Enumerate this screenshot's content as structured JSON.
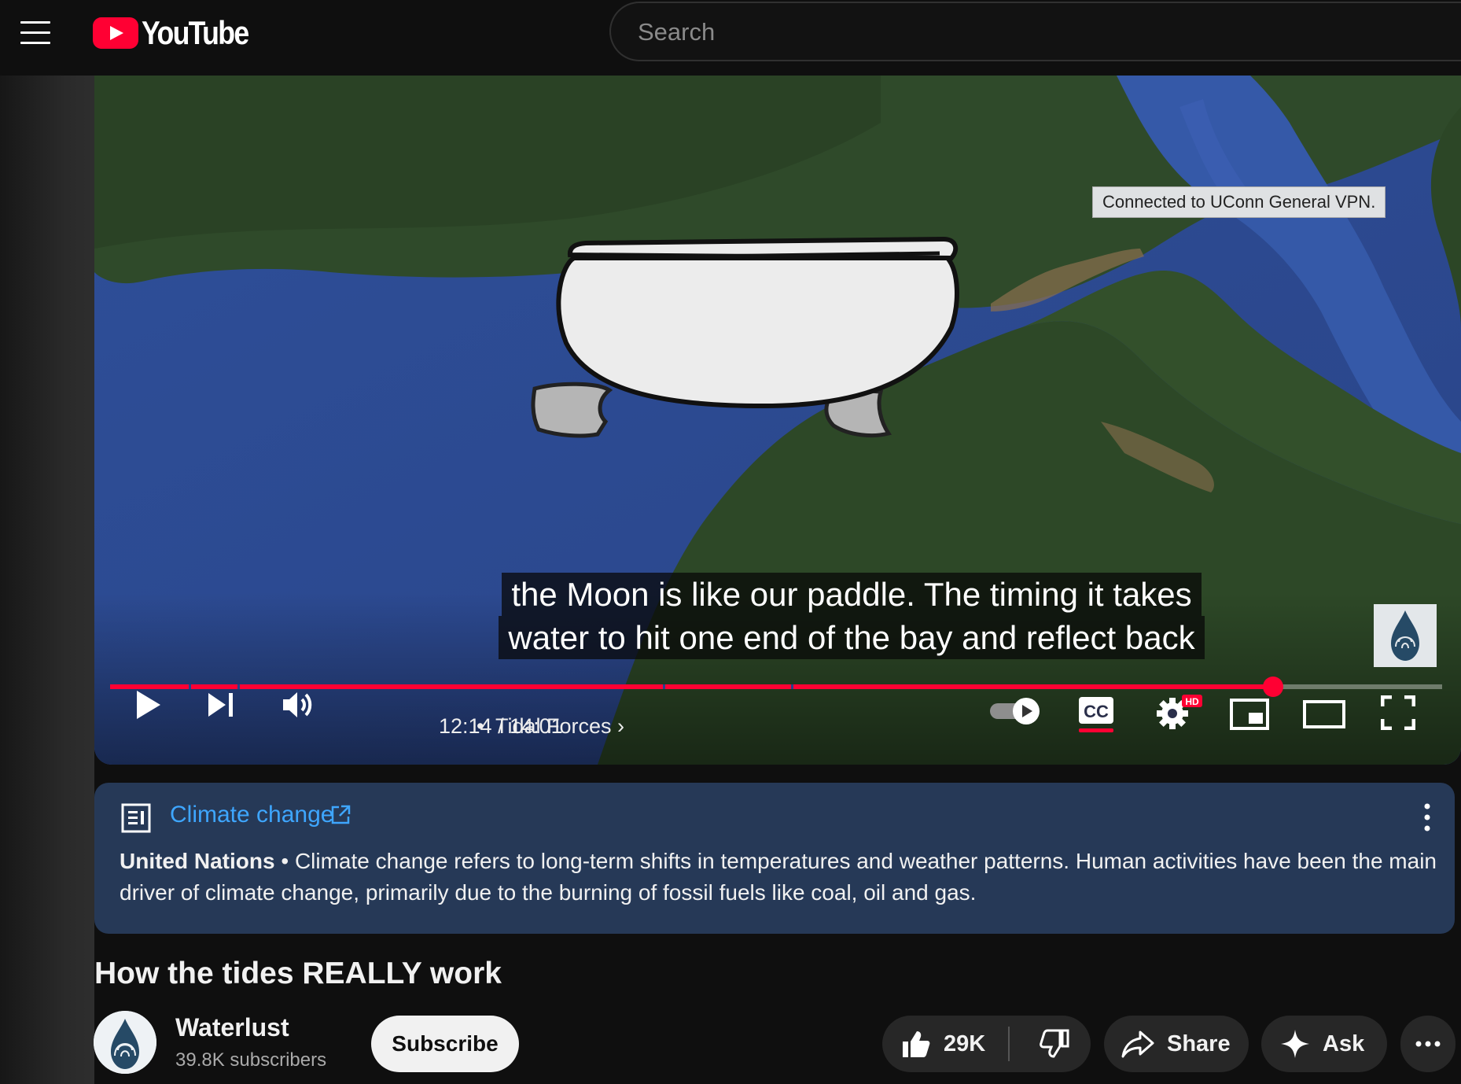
{
  "header": {
    "logo_text": "YouTube",
    "search_placeholder": "Search"
  },
  "player": {
    "vpn_notice": "Connected to UConn General VPN.",
    "caption_line1": "the Moon is like our paddle. The timing it takes",
    "caption_line2": "water to hit one end of the bay and reflect back",
    "progress": 0.8728,
    "chapter_markers": [
      0.0592,
      0.0957,
      0.4148,
      0.5111
    ],
    "current_time": "12:14",
    "duration": "14:01",
    "chapter_title": "Tidal Forces",
    "settings_badge": "HD"
  },
  "info_panel": {
    "topic": "Climate change",
    "source": "United Nations",
    "text": "Climate change refers to long-term shifts in temperatures and weather patterns. Human activities have been the main driver of climate change, primarily due to the burning of fossil fuels like coal, oil and gas."
  },
  "video": {
    "title": "How the tides REALLY work",
    "channel_name": "Waterlust",
    "subscribers": "39.8K subscribers",
    "subscribe_label": "Subscribe",
    "likes": "29K",
    "share_label": "Share",
    "ask_label": "Ask"
  },
  "colors": {
    "accent_red": "#ff0033",
    "link_blue": "#3ea6ff",
    "info_bg": "#263957"
  },
  "icons": [
    "menu-icon",
    "youtube-logo-icon",
    "play-icon",
    "next-icon",
    "volume-icon",
    "autoplay-toggle-icon",
    "cc-icon",
    "settings-icon",
    "miniplayer-icon",
    "theater-icon",
    "fullscreen-icon",
    "article-icon",
    "external-link-icon",
    "more-vertical-icon",
    "thumbs-up-icon",
    "thumbs-down-icon",
    "share-icon",
    "sparkle-icon",
    "more-horizontal-icon"
  ]
}
